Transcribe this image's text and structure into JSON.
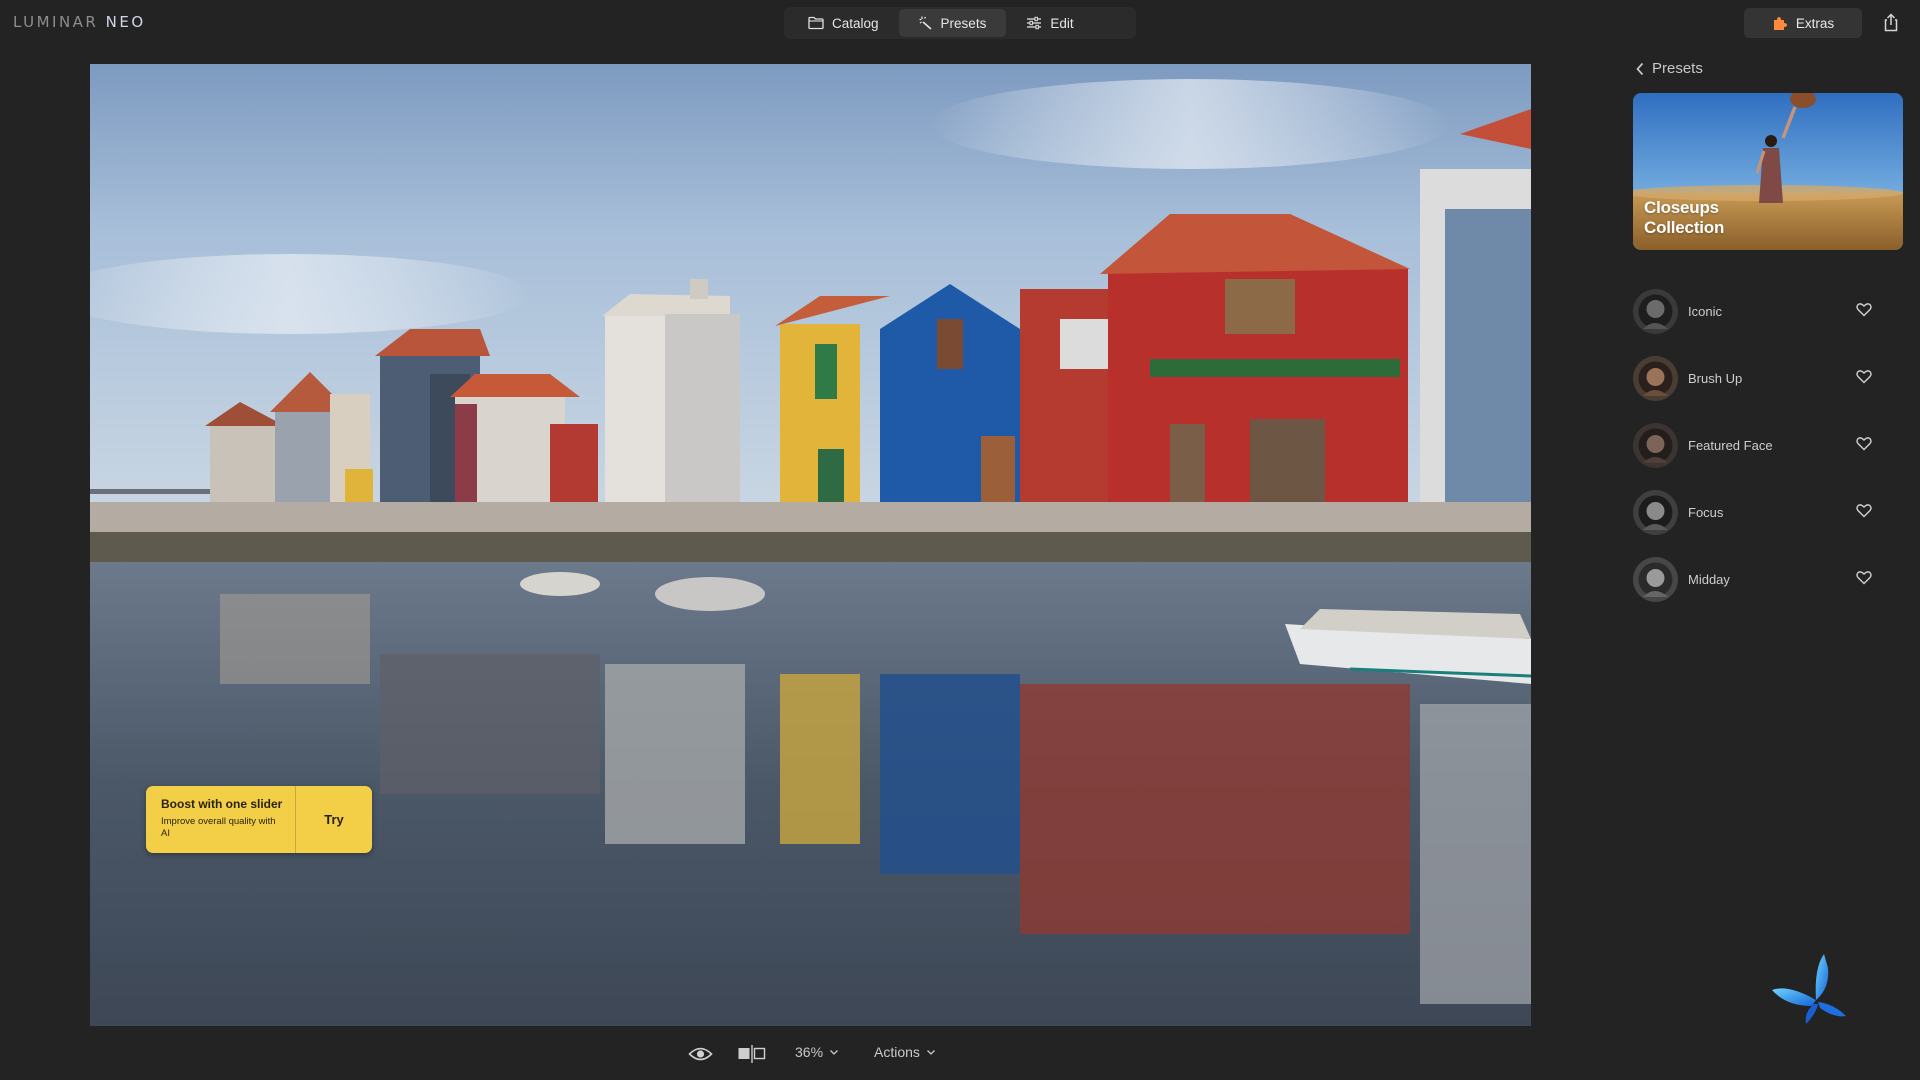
{
  "app": {
    "logo_main": "LUMINAR",
    "logo_accent": "NEO"
  },
  "modes": [
    {
      "label": "Catalog",
      "icon": "folder-icon",
      "active": false
    },
    {
      "label": "Presets",
      "icon": "presets-wand-icon",
      "active": true
    },
    {
      "label": "Edit",
      "icon": "sliders-icon",
      "active": false
    }
  ],
  "extras": {
    "label": "Extras",
    "icon": "puzzle-icon",
    "accent": "#ff8a3d"
  },
  "share": {
    "icon": "share-icon"
  },
  "boost": {
    "title": "Boost with one slider",
    "subtitle": "Improve overall quality with AI",
    "try_label": "Try",
    "color": "#f3cf47"
  },
  "bottombar": {
    "zoom": "36%",
    "actions": "Actions"
  },
  "panel": {
    "back_label": "Presets",
    "collection": {
      "line1": "Closeups",
      "line2": "Collection"
    },
    "presets": [
      {
        "name": "Iconic"
      },
      {
        "name": "Brush Up"
      },
      {
        "name": "Featured Face"
      },
      {
        "name": "Focus"
      },
      {
        "name": "Midday"
      }
    ]
  }
}
